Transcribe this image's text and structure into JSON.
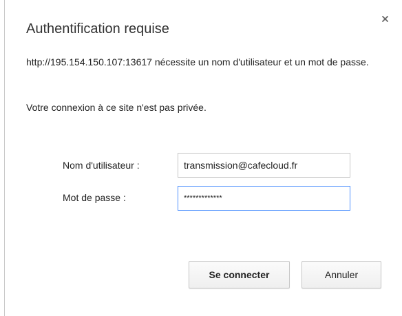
{
  "dialog": {
    "title": "Authentification requise",
    "message": "http://195.154.150.107:13617 nécessite un nom d'utilisateur et un mot de passe.",
    "privacy_note": "Votre connexion à ce site n'est pas privée.",
    "close_icon": "close-icon"
  },
  "form": {
    "username_label": "Nom d'utilisateur :",
    "username_value": "transmission@cafecloud.fr",
    "password_label": "Mot de passe :",
    "password_value": "*************"
  },
  "buttons": {
    "connect_label": "Se connecter",
    "cancel_label": "Annuler"
  },
  "colors": {
    "focus_border": "#4d90fe",
    "input_border": "#c6c6c6"
  }
}
